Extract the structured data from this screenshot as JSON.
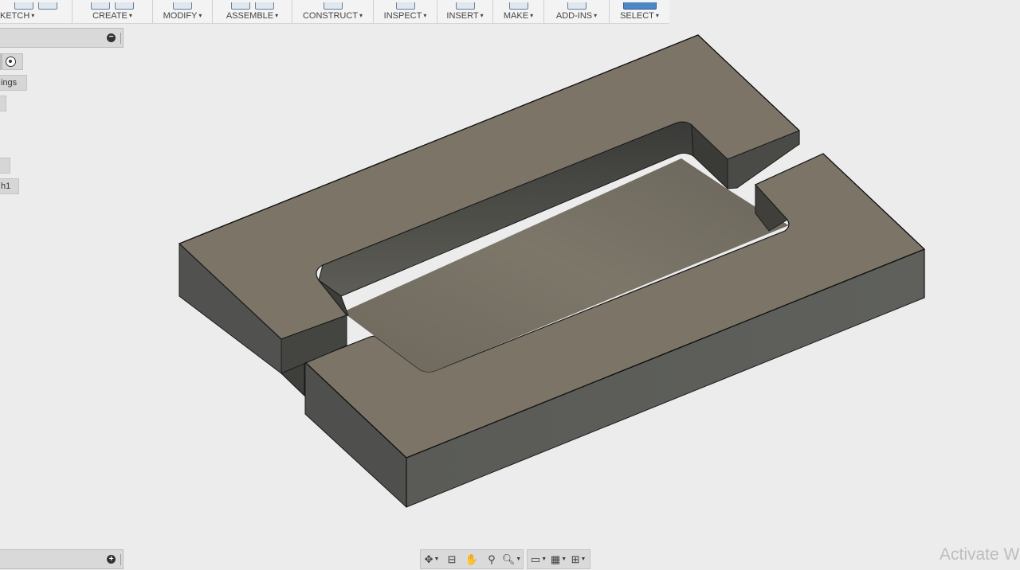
{
  "toolbar": {
    "groups": [
      {
        "label": "KETCH"
      },
      {
        "label": "CREATE"
      },
      {
        "label": "MODIFY"
      },
      {
        "label": "ASSEMBLE"
      },
      {
        "label": "CONSTRUCT"
      },
      {
        "label": "INSPECT"
      },
      {
        "label": "INSERT"
      },
      {
        "label": "MAKE"
      },
      {
        "label": "ADD-INS"
      },
      {
        "label": "SELECT"
      }
    ],
    "caret": "▾"
  },
  "browser": {
    "collapse_glyph": "−",
    "items": [
      {
        "label": "ings"
      },
      {
        "label": ""
      },
      {
        "label": ""
      },
      {
        "label": "h1"
      }
    ]
  },
  "comments": {
    "expand_glyph": "+"
  },
  "navbar": {
    "icons": [
      "orbit-icon",
      "look-at-icon",
      "pan-icon",
      "zoom-icon",
      "fit-icon",
      "display-settings-icon",
      "grid-settings-icon",
      "viewports-icon"
    ]
  },
  "watermark": {
    "text": "Activate W"
  },
  "colors": {
    "background": "#ececec",
    "top_face": "#7b7467",
    "front_face": "#5c5d59",
    "accent": "#4f86c6"
  }
}
